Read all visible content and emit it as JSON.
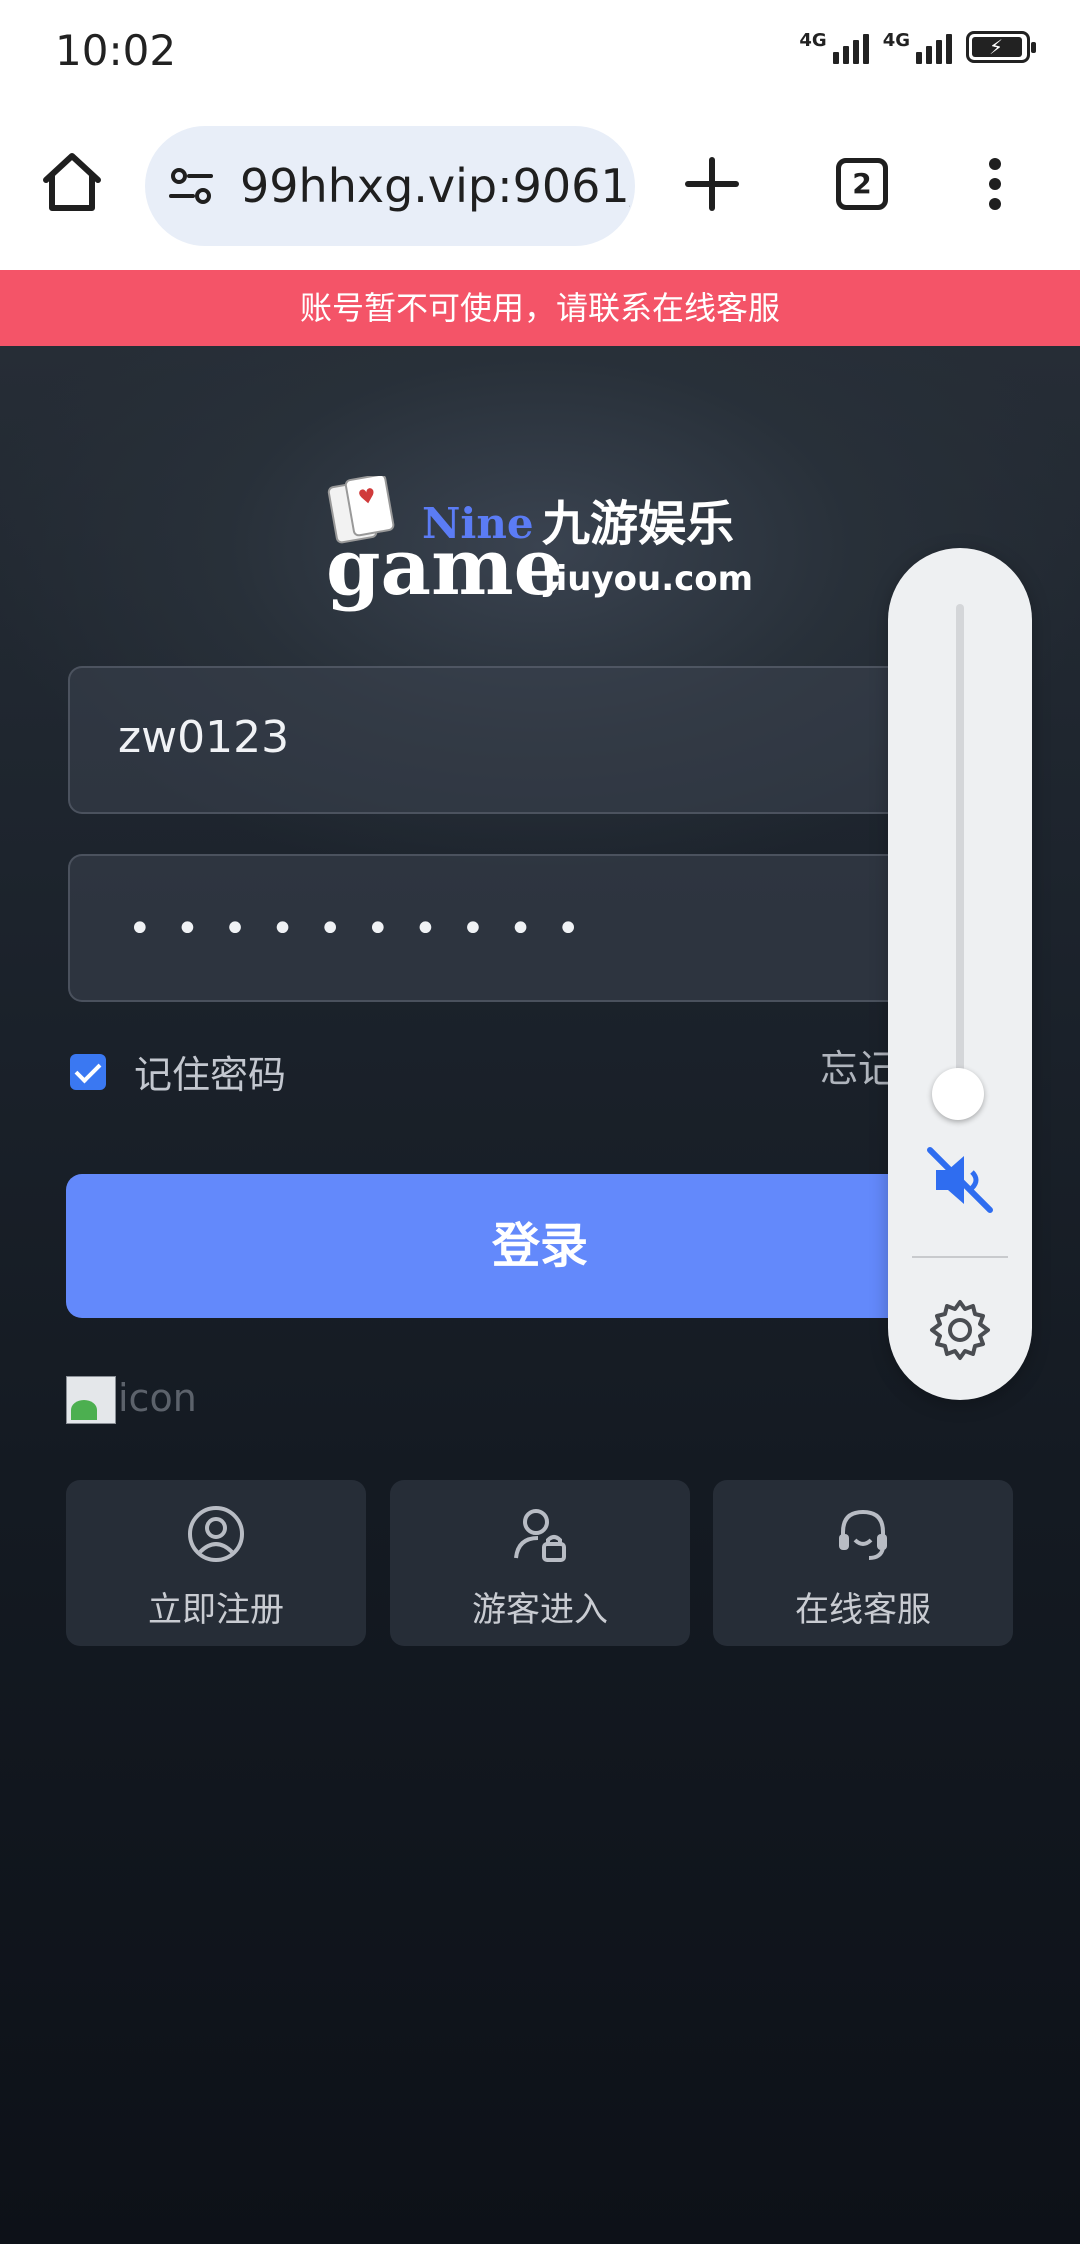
{
  "status_bar": {
    "time": "10:02",
    "signal1_label": "4G",
    "signal2_label": "4G"
  },
  "browser": {
    "url": "99hhxg.vip:9061/",
    "tab_count": "2"
  },
  "notice": "账号暂不可使用，请联系在线客服",
  "logo": {
    "text_nine": "Nine",
    "text_game": "game",
    "text_cn": "九游娱乐",
    "text_domain": "jiuyou.com"
  },
  "login_form": {
    "username": "zw0123",
    "password_mask": "••••••••••",
    "remember_label": "记住密码",
    "remember_checked": true,
    "forgot_label": "忘记密码?",
    "login_button": "登录"
  },
  "broken_image_alt": "icon",
  "quick_actions": [
    {
      "label": "立即注册",
      "icon": "user-circle-icon"
    },
    {
      "label": "游客进入",
      "icon": "guest-lock-icon"
    },
    {
      "label": "在线客服",
      "icon": "headset-icon"
    }
  ],
  "volume_panel": {
    "level": 0.0,
    "muted": true
  },
  "colors": {
    "notice_bg": "#f45468",
    "login_button_bg": "#6389fb",
    "checkbox": "#3a78f2"
  }
}
